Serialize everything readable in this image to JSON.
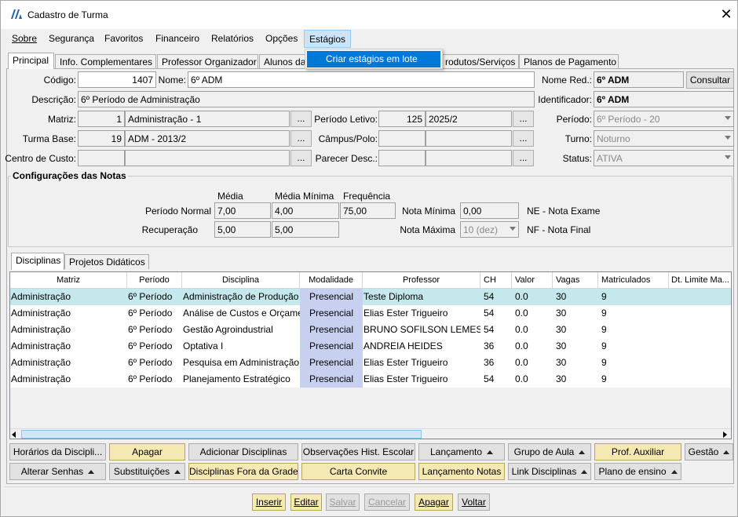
{
  "window": {
    "title": "Cadastro de Turma",
    "bg_title": "Cadastro de Turma"
  },
  "menu": [
    "Sobre",
    "Segurança",
    "Favoritos",
    "Financeiro",
    "Relatórios",
    "Opções",
    "Estágios"
  ],
  "dropdown": {
    "item": "Criar estágios em lote"
  },
  "tabs": [
    "Principal",
    "Info. Complementares",
    "Professor Organizador",
    "Alunos da",
    "rodutos/Serviços",
    "Planos de Pagamento"
  ],
  "form": {
    "codigo_label": "Código:",
    "codigo": "1407",
    "nome_label": "Nome:",
    "nome": "6º ADM",
    "nome_red_label": "Nome Red.:",
    "nome_red": "6º ADM",
    "consultar": "Consultar",
    "descricao_label": "Descrição:",
    "descricao": "6º Período de Administração",
    "identificador_label": "Identificador:",
    "identificador": "6º ADM",
    "matriz_label": "Matriz:",
    "matriz_id": "1",
    "matriz_nome": "Administração - 1",
    "periodo_letivo_label": "Período Letivo:",
    "periodo_letivo_id": "125",
    "periodo_letivo_nome": "2025/2",
    "periodo_label": "Período:",
    "periodo": "6º Período - 20",
    "turma_base_label": "Turma Base:",
    "turma_base_id": "19",
    "turma_base_nome": "ADM - 2013/2",
    "campus_label": "Câmpus/Polo:",
    "turno_label": "Turno:",
    "turno": "Noturno",
    "centro_custo_label": "Centro de Custo:",
    "parecer_label": "Parecer Desc.:",
    "status_label": "Status:",
    "status": "ATIVA",
    "ellipsis": "..."
  },
  "notas": {
    "title": "Configurações das Notas",
    "col_media": "Média",
    "col_media_min": "Média Mínima",
    "col_freq": "Frequência",
    "normal_label": "Período Normal",
    "normal_media": "7,00",
    "normal_media_min": "4,00",
    "normal_freq": "75,00",
    "rec_label": "Recuperação",
    "rec_media": "5,00",
    "rec_media_min": "5,00",
    "nota_min_label": "Nota Mínima",
    "nota_min": "0,00",
    "nota_max_label": "Nota Máxima",
    "nota_max": "10 (dez)",
    "ne": "NE - Nota Exame",
    "nf": "NF - Nota Final"
  },
  "subtabs": [
    "Disciplinas",
    "Projetos Didáticos"
  ],
  "grid": {
    "headers": [
      "Matriz",
      "Período",
      "Disciplina",
      "Modalidade",
      "Professor",
      "CH",
      "Valor",
      "Vagas",
      "Matriculados",
      "Dt. Limite Ma..."
    ],
    "rows": [
      [
        "Administração",
        "6º Período",
        "Administração de Produção",
        "Presencial",
        "Teste Diploma",
        "54",
        "0.0",
        "30",
        "9"
      ],
      [
        "Administração",
        "6º Período",
        "Análise de Custos e Orçamento",
        "Presencial",
        "Elias Ester Trigueiro",
        "54",
        "0.0",
        "30",
        "9"
      ],
      [
        "Administração",
        "6º Período",
        "Gestão Agroindustrial",
        "Presencial",
        "BRUNO SOFILSON LEMES",
        "54",
        "0.0",
        "30",
        "9"
      ],
      [
        "Administração",
        "6º Período",
        "Optativa I",
        "Presencial",
        "ANDREIA HEIDES",
        "36",
        "0.0",
        "30",
        "9"
      ],
      [
        "Administração",
        "6º Período",
        "Pesquisa em Administração",
        "Presencial",
        "Elias Ester Trigueiro",
        "36",
        "0.0",
        "30",
        "9"
      ],
      [
        "Administração",
        "6º Período",
        "Planejamento Estratégico",
        "Presencial",
        "Elias Ester Trigueiro",
        "54",
        "0.0",
        "30",
        "9"
      ]
    ]
  },
  "actions_row1": [
    "Horários da Discipli...",
    "Apagar",
    "Adicionar Disciplinas",
    "Observações Hist. Escolar",
    "Lançamento",
    "Grupo de Aula",
    "Prof. Auxiliar",
    "Gestão"
  ],
  "actions_row2": [
    "Alterar Senhas",
    "Substituições",
    "Disciplinas Fora da Grade",
    "Carta Convite",
    "Lançamento Notas",
    "Link Disciplinas",
    "Plano de ensino"
  ],
  "footer": [
    "Inserir",
    "Editar",
    "Salvar",
    "Cancelar",
    "Apagar",
    "Voltar"
  ]
}
